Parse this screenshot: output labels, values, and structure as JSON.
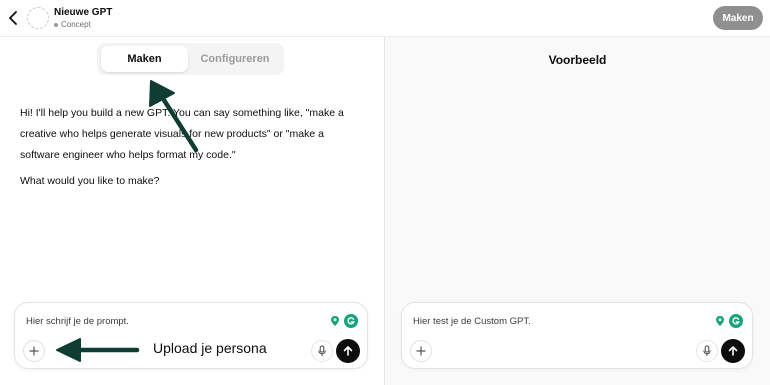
{
  "header": {
    "gpt_name": "Nieuwe GPT",
    "status": "Concept",
    "create_button": "Maken"
  },
  "tabs": [
    {
      "label": "Maken",
      "active": true
    },
    {
      "label": "Configureren",
      "active": false
    }
  ],
  "message": {
    "paragraph_1": "Hi! I'll help you build a new GPT. You can say something like, \"make a creative who helps generate visuals for new products\" or \"make a software engineer who helps format my code.\"",
    "paragraph_2": "What would you like to make?"
  },
  "composer_left": {
    "placeholder": "Hier schrijf je de prompt."
  },
  "annotation": {
    "upload_label": "Upload je persona"
  },
  "preview": {
    "title": "Voorbeeld",
    "composer_placeholder": "Hier test je de Custom GPT."
  },
  "colors": {
    "annotation_arrow": "#0f3d34",
    "extension_green": "#15a37c",
    "send_button": "#0d0d0d"
  },
  "icons": [
    "chevron-left-icon",
    "avatar-placeholder-icon",
    "plus-icon",
    "mic-icon",
    "arrow-up-icon",
    "location-pin-icon",
    "grammarly-icon",
    "annotation-arrow"
  ]
}
